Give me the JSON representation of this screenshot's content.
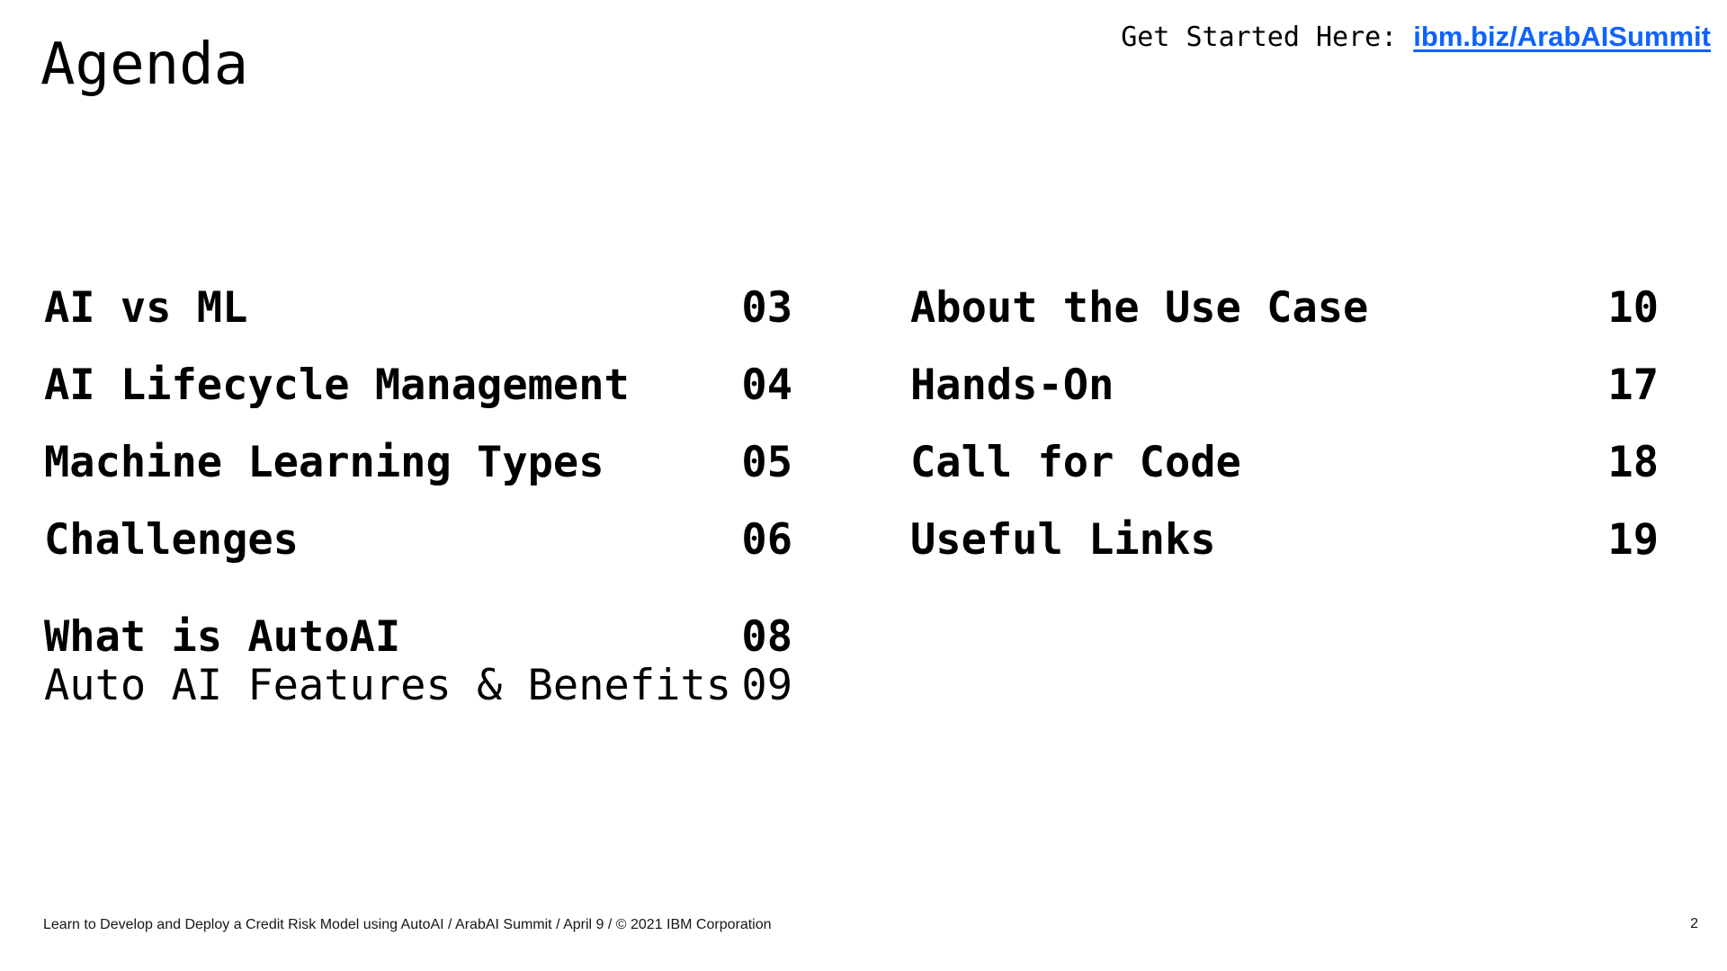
{
  "title": "Agenda",
  "get_started": {
    "prefix": "Get Started Here:",
    "link": "ibm.biz/ArabAISummit",
    "link_color": "#0f62fe"
  },
  "agenda_left": [
    {
      "label": "AI vs ML",
      "page": "03"
    },
    {
      "label": "AI Lifecycle Management",
      "page": "04"
    },
    {
      "label": "Machine Learning Types",
      "page": "05"
    },
    {
      "label": "Challenges",
      "page": "06"
    },
    {
      "label": "What is AutoAI",
      "page": "08"
    },
    {
      "label": "Auto AI Features & Benefits",
      "page": "09"
    }
  ],
  "agenda_right": [
    {
      "label": "About the Use Case",
      "page": "10"
    },
    {
      "label": "Hands-On",
      "page": "17"
    },
    {
      "label": "Call for Code",
      "page": "18"
    },
    {
      "label": "Useful Links",
      "page": "19"
    }
  ],
  "footer": {
    "text": "Learn to Develop and Deploy a Credit Risk Model using AutoAI / ArabAI Summit / April 9 / © 2021 IBM Corporation",
    "page_number": "2"
  }
}
